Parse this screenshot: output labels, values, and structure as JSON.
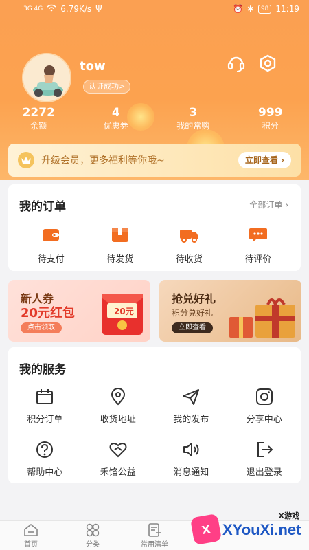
{
  "status_bar": {
    "signal": "3G 4G",
    "speed": "6.79K/s",
    "battery": "98",
    "time": "11:19"
  },
  "profile": {
    "username": "tow",
    "verify_badge": "认证成功>"
  },
  "stats": [
    {
      "value": "2272",
      "label": "余额"
    },
    {
      "value": "4",
      "label": "优惠券"
    },
    {
      "value": "3",
      "label": "我的常购"
    },
    {
      "value": "999",
      "label": "积分"
    }
  ],
  "vip": {
    "text": "升级会员，更多福利等你哦~",
    "button": "立即查看 ›"
  },
  "orders": {
    "title": "我的订单",
    "all_link": "全部订单 ›",
    "items": [
      {
        "label": "待支付",
        "icon": "wallet-icon"
      },
      {
        "label": "待发货",
        "icon": "package-icon"
      },
      {
        "label": "待收货",
        "icon": "truck-icon"
      },
      {
        "label": "待评价",
        "icon": "comment-icon"
      }
    ]
  },
  "promos": {
    "left": {
      "title": "新人券",
      "subtitle": "20元红包",
      "chip": "点击领取",
      "envelope_text": "20元"
    },
    "right": {
      "title": "抢兑好礼",
      "subtitle": "积分兑好礼",
      "chip": "立即查看"
    }
  },
  "services": {
    "title": "我的服务",
    "items": [
      {
        "label": "积分订单",
        "icon": "calendar-icon"
      },
      {
        "label": "收货地址",
        "icon": "location-icon"
      },
      {
        "label": "我的发布",
        "icon": "send-icon"
      },
      {
        "label": "分享中心",
        "icon": "share-icon"
      },
      {
        "label": "帮助中心",
        "icon": "help-icon"
      },
      {
        "label": "禾馅公益",
        "icon": "heart-icon"
      },
      {
        "label": "消息通知",
        "icon": "speaker-icon"
      },
      {
        "label": "退出登录",
        "icon": "logout-icon"
      }
    ]
  },
  "tabbar": [
    {
      "label": "首页",
      "icon": "home-icon"
    },
    {
      "label": "分类",
      "icon": "category-icon"
    },
    {
      "label": "常用清单",
      "icon": "list-icon"
    }
  ],
  "watermark": {
    "top": "X游戏",
    "brand": "XYouXi.net",
    "mark": "X"
  },
  "colors": {
    "accent": "#fca24f",
    "icon_orange": "#f26d21"
  }
}
